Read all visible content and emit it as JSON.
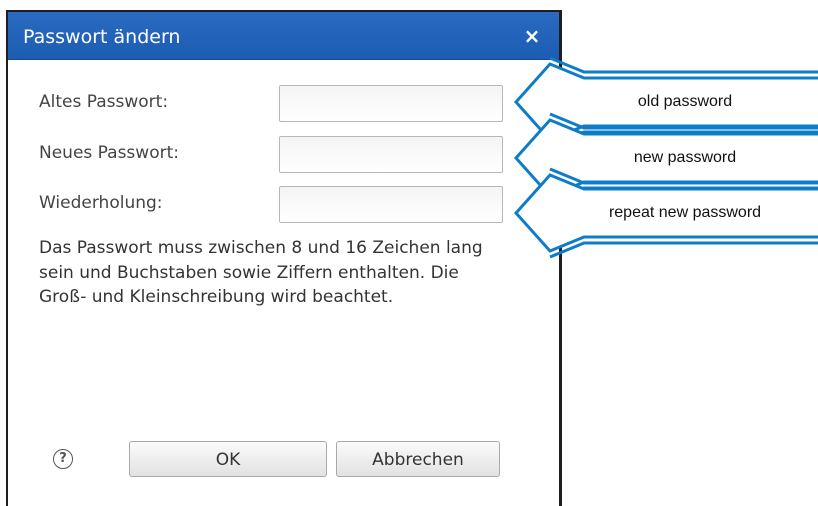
{
  "dialog": {
    "title": "Passwort ändern",
    "close_label": "×",
    "fields": [
      {
        "label": "Altes Passwort:",
        "value": ""
      },
      {
        "label": "Neues Passwort:",
        "value": ""
      },
      {
        "label": "Wiederholung:",
        "value": ""
      }
    ],
    "hint": "Das Passwort muss zwischen 8 und 16 Zeichen lang sein und Buchstaben sowie Ziffern enthalten. Die Groß- und Kleinschreibung wird beachtet.",
    "help_symbol": "?",
    "ok_label": "OK",
    "cancel_label": "Abbrechen"
  },
  "annotations": [
    {
      "label": "old password"
    },
    {
      "label": "new password"
    },
    {
      "label": "repeat new password"
    }
  ],
  "colors": {
    "titlebar": "#1d5cb3",
    "callout_stroke": "#0d7cc9"
  }
}
